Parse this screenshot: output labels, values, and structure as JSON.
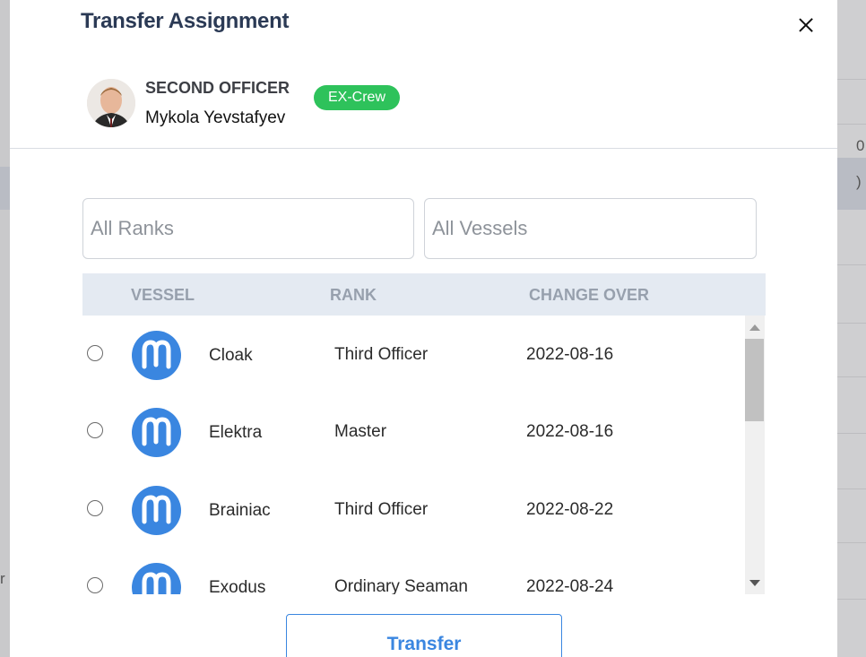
{
  "background": {
    "left_fragment": "r",
    "right_fragment_1": "0",
    "right_fragment_2": ")"
  },
  "modal": {
    "title": "Transfer Assignment",
    "close_icon": "close-icon"
  },
  "crew": {
    "rank": "SECOND OFFICER",
    "name": "Mykola Yevstafyev",
    "status": "EX-Crew",
    "status_color": "#2ec25b"
  },
  "filters": {
    "ranks_placeholder": "All Ranks",
    "vessels_placeholder": "All Vessels"
  },
  "table": {
    "headers": {
      "vessel": "VESSEL",
      "rank": "RANK",
      "change_over": "CHANGE OVER"
    },
    "rows": [
      {
        "vessel": "Cloak",
        "rank": "Third Officer",
        "change_over": "2022-08-16"
      },
      {
        "vessel": "Elektra",
        "rank": "Master",
        "change_over": "2022-08-16"
      },
      {
        "vessel": "Brainiac",
        "rank": "Third Officer",
        "change_over": "2022-08-22"
      },
      {
        "vessel": "Exodus",
        "rank": "Ordinary Seaman",
        "change_over": "2022-08-24"
      }
    ]
  },
  "actions": {
    "transfer_label": "Transfer"
  },
  "colors": {
    "accent": "#3a86e0",
    "title": "#2b3a55",
    "header_bg": "#e4eaf2"
  }
}
